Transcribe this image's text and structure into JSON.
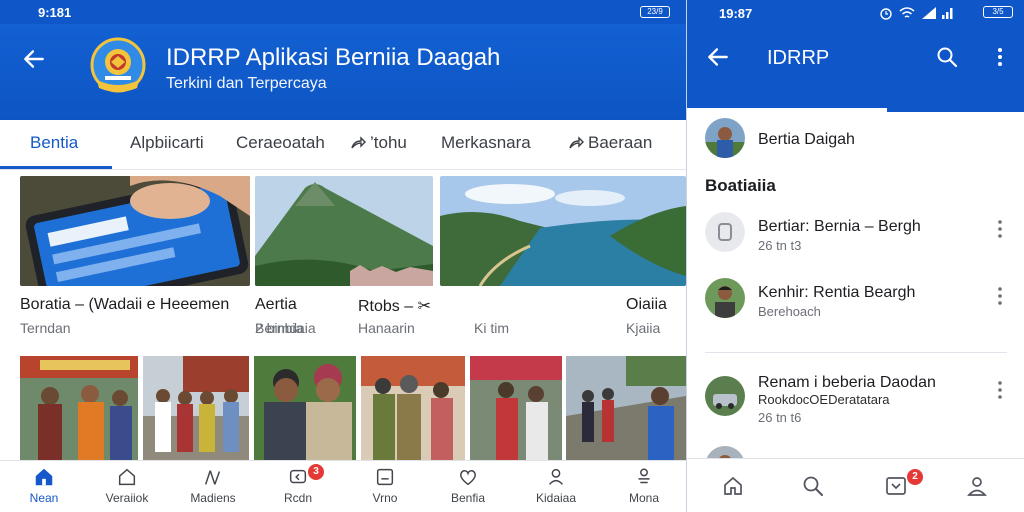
{
  "left": {
    "status": {
      "time": "9:181",
      "battery": "23/9"
    },
    "appbar": {
      "title": "IDRRP  Aplikasi Berniia Daagah",
      "subtitle": "Terkini dan Terpercaya"
    },
    "tabs": [
      {
        "label": "Bentia",
        "active": true
      },
      {
        "label": "Alpbiicarti"
      },
      {
        "label": "Ceraeoatah"
      },
      {
        "label": "’tohu",
        "icon": "share-icon"
      },
      {
        "label": "Merkasnara"
      },
      {
        "label": "Baeraan",
        "icon": "share-icon"
      }
    ],
    "cards": [
      {
        "title": "Boratia – (Wadaii e Heeemen",
        "meta": "Terndan",
        "image": "phone-app-photo"
      },
      {
        "title": "Aertia",
        "meta": "Bernbia",
        "image": "volcano-photo"
      },
      {
        "title": "Rtobs – ✂",
        "meta": "2 bimdaia",
        "image": ""
      },
      {
        "title": "",
        "meta": "Hanaarin",
        "image": ""
      },
      {
        "title": "",
        "meta": "Ki tim",
        "image": "coastal-bay-photo"
      },
      {
        "title": "Oiaiia",
        "meta": "Kjaiia",
        "image": ""
      }
    ],
    "photos": [
      "people-market-photo",
      "officials-group-photo",
      "village-elders-photo",
      "village-street-photo",
      "community-event-photo",
      "road-gathering-photo"
    ],
    "bottomnav": [
      {
        "label": "Nean",
        "icon": "home-icon",
        "active": true
      },
      {
        "label": "Veraiiok",
        "icon": "house-outline-icon"
      },
      {
        "label": "Madiens",
        "icon": "pen-icon"
      },
      {
        "label": "Rcdn",
        "icon": "chat-icon",
        "badge": "3"
      },
      {
        "label": "Vrno",
        "icon": "video-icon"
      },
      {
        "label": "Benfia",
        "icon": "heart-icon"
      },
      {
        "label": "Kidaiaa",
        "icon": "person-icon"
      },
      {
        "label": "Mona",
        "icon": "menu-person-icon"
      }
    ]
  },
  "right": {
    "status": {
      "time": "19:87",
      "battery": "3/5"
    },
    "appbar": {
      "title": "IDRRP"
    },
    "profile": {
      "name": "Bertia Daigah"
    },
    "section": "Boatiaiia",
    "items": [
      {
        "title": "Bertiar: Bernia – Bergh",
        "sub": "26 tn t3",
        "avatar": "device-avatar"
      },
      {
        "title": "Kenhir: Rentia Beargh",
        "sub": "Berehoach",
        "avatar": "man-avatar"
      },
      {
        "title": "Renam i beberia Daodan",
        "sub": "RookdocOEDeratatara",
        "sub2": "26 tn t6",
        "avatar": "car-avatar"
      }
    ],
    "bottomnav": [
      {
        "icon": "home-icon"
      },
      {
        "icon": "search-icon"
      },
      {
        "icon": "inbox-icon",
        "badge": "2"
      },
      {
        "icon": "profile-icon"
      }
    ]
  },
  "colors": {
    "primary": "#0f57c9",
    "accent": "#1558c9",
    "badge": "#e53935"
  }
}
